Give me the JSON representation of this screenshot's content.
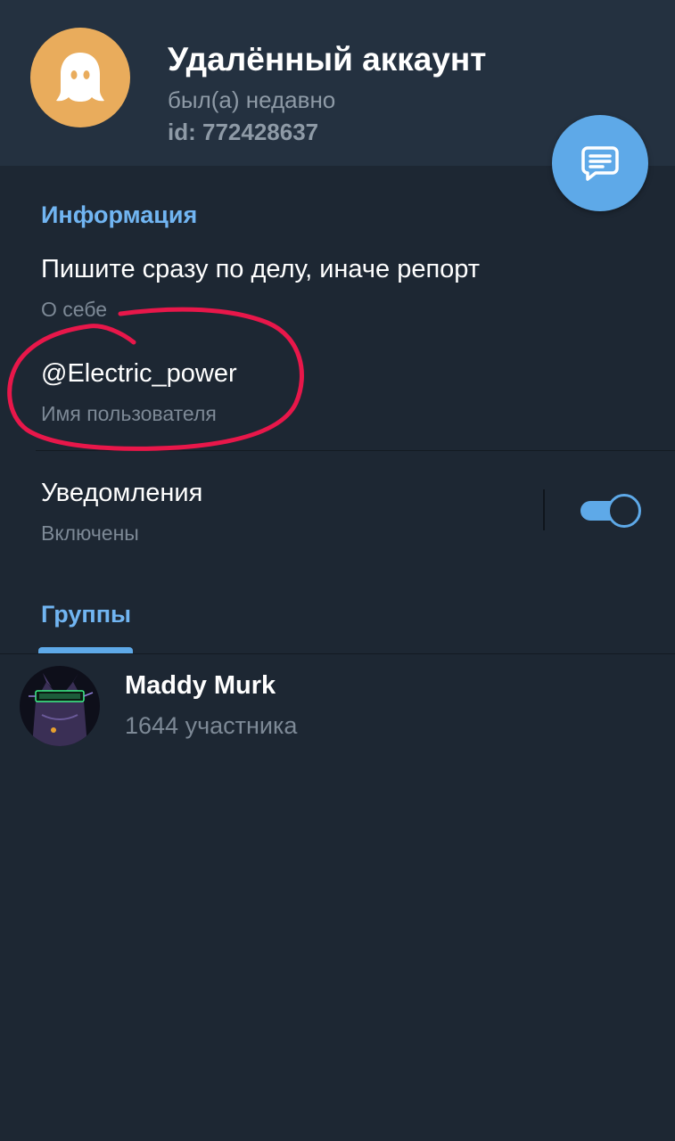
{
  "profile": {
    "name": "Удалённый аккаунт",
    "status": "был(а) недавно",
    "id": "id: 772428637",
    "avatar_icon": "ghost-icon",
    "avatar_color": "#e9ac5c"
  },
  "fab": {
    "icon": "message-icon"
  },
  "info": {
    "section_title": "Информация",
    "bio": "Пишите сразу по делу, иначе репорт",
    "bio_label": "О себе",
    "username": "@Electric_power",
    "username_label": "Имя пользователя"
  },
  "notifications": {
    "label": "Уведомления",
    "value": "Включены",
    "enabled": true
  },
  "groups": {
    "section_title": "Группы",
    "items": [
      {
        "name": "Maddy Murk",
        "members": "1644 участника"
      }
    ]
  },
  "colors": {
    "background": "#1d2733",
    "header": "#243140",
    "accent": "#5ea9e8",
    "section_title": "#71b5f2",
    "annotation": "#e8174a"
  }
}
